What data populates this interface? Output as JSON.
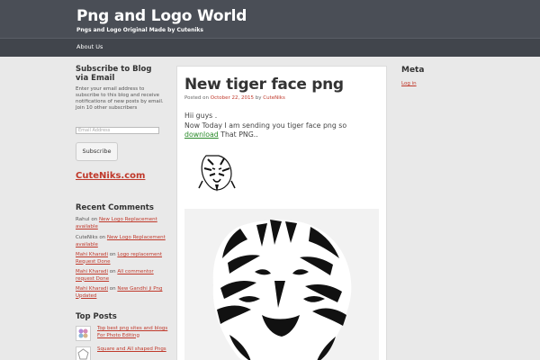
{
  "header": {
    "site_title": "Png and Logo World",
    "site_description": "Pngs and Logo Original Made by Cuteniks"
  },
  "nav": {
    "items": [
      {
        "label": "About Us"
      }
    ]
  },
  "sidebar_left": {
    "subscribe": {
      "title": "Subscribe to Blog via Email",
      "description": "Enter your email address to subscribe to this blog and receive notifications of new posts by email.",
      "subscribers_text": "Join 10 other subscribers",
      "email_placeholder": "Email Address",
      "button_label": "Subscribe"
    },
    "cuteniks_link": "CuteNiks.com",
    "recent_comments": {
      "title": "Recent Comments",
      "items": [
        {
          "author": "Rahul",
          "on": "on",
          "post": "New Logo Replacement available"
        },
        {
          "author": "CuteNiks",
          "on": "on",
          "post": "New Logo Replacement available"
        },
        {
          "author": "Mahi Kharadi",
          "on": "on",
          "post": "Logo replacement Request Done"
        },
        {
          "author": "Mahi Kharadi",
          "on": "on",
          "post": "All commentor request Done"
        },
        {
          "author": "Mahi Kharadi",
          "on": "on",
          "post": "New Gandhi ji Png Updated"
        }
      ]
    },
    "top_posts": {
      "title": "Top Posts",
      "items": [
        {
          "label": "Top best png sites and blogs For Photo Editing"
        },
        {
          "label": "Square and All shaped Pngs"
        }
      ]
    }
  },
  "post": {
    "title": "New tiger face png",
    "meta": {
      "posted_on": "Posted on",
      "date": "October 22, 2015",
      "by": "by",
      "author": "CuteNiks"
    },
    "body_line1": "Hii guys .",
    "body_line2_pre": "Now Today I am sending you tiger face png so",
    "download_link": "download",
    "body_line2_post": "That PNG.."
  },
  "sidebar_right": {
    "meta_title": "Meta",
    "login_label": "Log in"
  },
  "colors": {
    "header_bg": "#4a4e56",
    "link_red": "#c0392b",
    "download_green": "#2a8a2a",
    "page_bg": "#e9e9e9"
  }
}
